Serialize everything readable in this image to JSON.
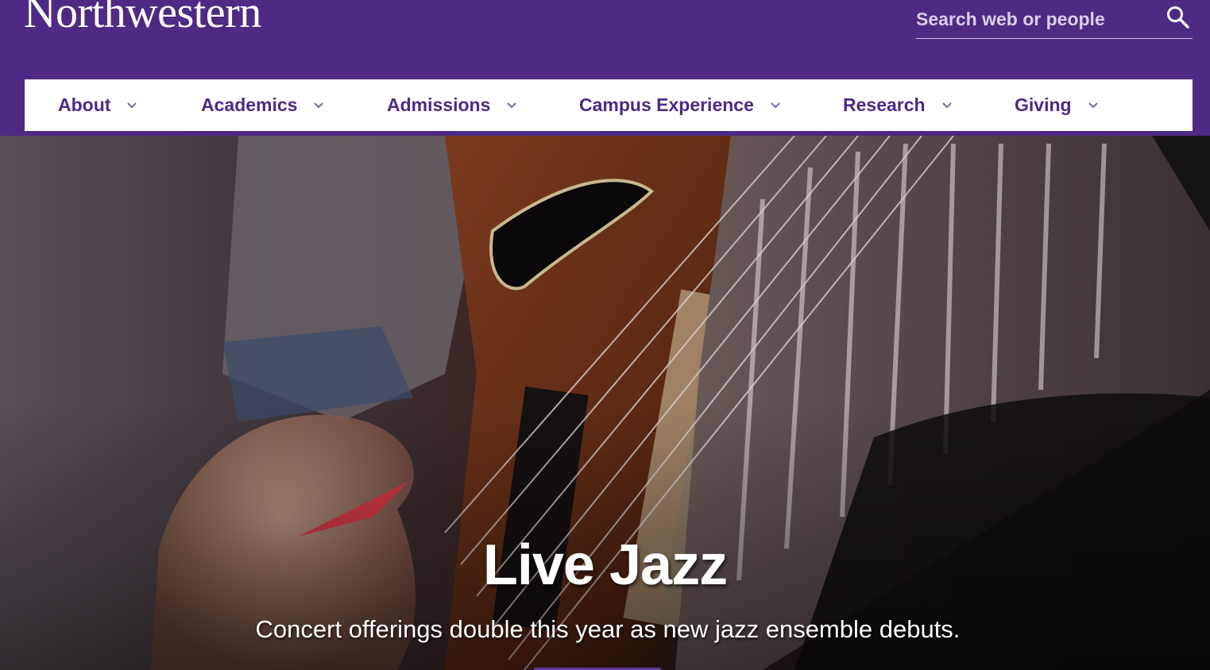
{
  "header": {
    "logo_text": "Northwestern",
    "search": {
      "placeholder": "Search web or people",
      "icon": "search-icon"
    }
  },
  "nav": {
    "items": [
      {
        "label": "About",
        "icon": "chevron-down-icon"
      },
      {
        "label": "Academics",
        "icon": "chevron-down-icon"
      },
      {
        "label": "Admissions",
        "icon": "chevron-down-icon"
      },
      {
        "label": "Campus Experience",
        "icon": "chevron-down-icon"
      },
      {
        "label": "Research",
        "icon": "chevron-down-icon"
      },
      {
        "label": "Giving",
        "icon": "chevron-down-icon"
      }
    ]
  },
  "hero": {
    "title": "Live Jazz",
    "subtitle": "Concert offerings double this year as new jazz ensemble debuts."
  },
  "colors": {
    "brand_purple": "#4e2a84",
    "nav_background": "#ffffff",
    "text_on_brand": "#ffffff"
  }
}
